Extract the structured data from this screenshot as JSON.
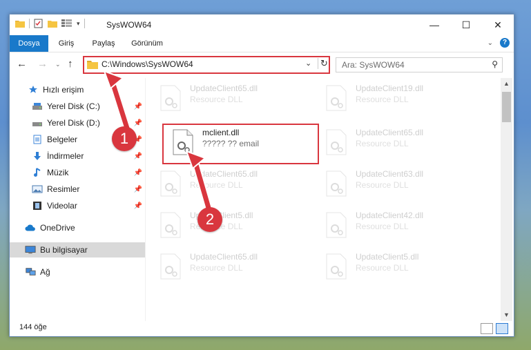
{
  "window": {
    "title": "SysWOW64",
    "controls": {
      "minimize": "—",
      "maximize": "☐",
      "close": "✕"
    }
  },
  "ribbon": {
    "tabs": [
      {
        "label": "Dosya",
        "active": true
      },
      {
        "label": "Giriş"
      },
      {
        "label": "Paylaş"
      },
      {
        "label": "Görünüm"
      }
    ]
  },
  "address": {
    "path": "C:\\Windows\\SysWOW64"
  },
  "search": {
    "placeholder": "Ara: SysWOW64"
  },
  "sidebar": {
    "items": [
      {
        "label": "Hızlı erişim",
        "icon": "star-icon"
      },
      {
        "label": "Yerel Disk (C:)",
        "icon": "drive-icon",
        "pinned": true
      },
      {
        "label": "Yerel Disk (D:)",
        "icon": "drive-icon",
        "pinned": true
      },
      {
        "label": "Belgeler",
        "icon": "documents-icon",
        "pinned": true
      },
      {
        "label": "İndirmeler",
        "icon": "download-icon",
        "pinned": true
      },
      {
        "label": "Müzik",
        "icon": "music-icon",
        "pinned": true
      },
      {
        "label": "Resimler",
        "icon": "pictures-icon",
        "pinned": true
      },
      {
        "label": "Videolar",
        "icon": "videos-icon",
        "pinned": true
      },
      {
        "label": "OneDrive",
        "icon": "cloud-icon"
      },
      {
        "label": "Bu bilgisayar",
        "icon": "computer-icon",
        "selected": true
      },
      {
        "label": "Ağ",
        "icon": "network-icon"
      }
    ]
  },
  "files": [
    {
      "name": "UpdateClient65.dll",
      "type": "Resource DLL",
      "faded": true
    },
    {
      "name": "UpdateClient19.dll",
      "type": "Resource DLL",
      "faded": true
    },
    {
      "name": "mclient.dll",
      "type": "????? ?? email",
      "faded": false
    },
    {
      "name": "UpdateClient65.dll",
      "type": "Resource DLL",
      "faded": true
    },
    {
      "name": "UpdateClient65.dll",
      "type": "Resource DLL",
      "faded": true
    },
    {
      "name": "UpdateClient63.dll",
      "type": "Resource DLL",
      "faded": true
    },
    {
      "name": "UpdateClient5.dll",
      "type": "Resource DLL",
      "faded": true
    },
    {
      "name": "UpdateClient42.dll",
      "type": "Resource DLL",
      "faded": true
    },
    {
      "name": "UpdateClient65.dll",
      "type": "Resource DLL",
      "faded": true
    },
    {
      "name": "UpdateClient5.dll",
      "type": "Resource DLL",
      "faded": true
    }
  ],
  "status": {
    "count": "144 öğe"
  },
  "callouts": [
    "1",
    "2"
  ],
  "colors": {
    "accent": "#1979ca",
    "highlight": "#d9363e"
  }
}
